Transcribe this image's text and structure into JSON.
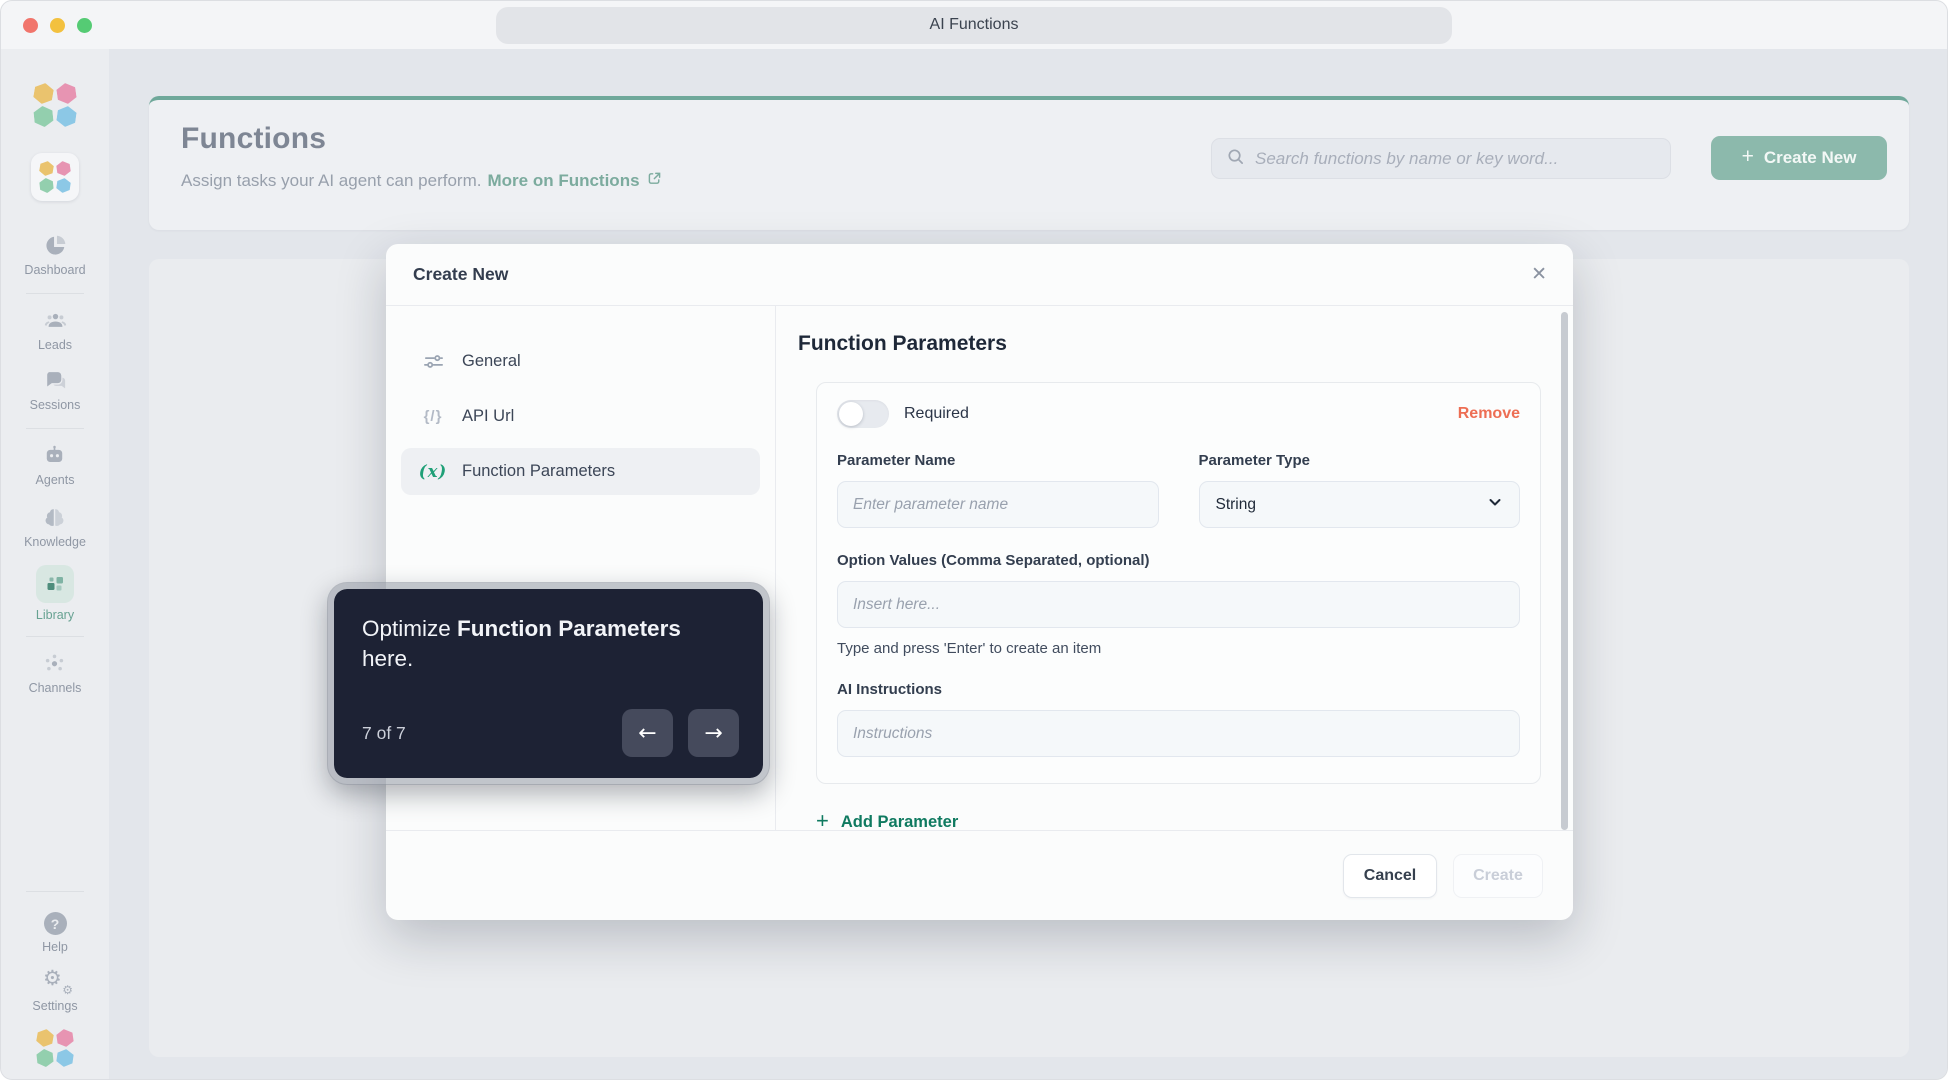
{
  "window": {
    "title": "AI Functions"
  },
  "sidebar": {
    "items": [
      {
        "label": "Dashboard",
        "icon": "pie-chart-icon"
      },
      {
        "label": "Leads",
        "icon": "people-icon"
      },
      {
        "label": "Sessions",
        "icon": "chat-bubbles-icon"
      },
      {
        "label": "Agents",
        "icon": "robot-icon"
      },
      {
        "label": "Knowledge",
        "icon": "brain-icon"
      },
      {
        "label": "Library",
        "icon": "grid-squares-icon",
        "active": true
      },
      {
        "label": "Channels",
        "icon": "network-icon"
      },
      {
        "label": "Help",
        "icon": "question-circle-icon"
      },
      {
        "label": "Settings",
        "icon": "gears-icon"
      }
    ]
  },
  "header": {
    "title": "Functions",
    "subtitle": "Assign tasks your AI agent can perform.",
    "link_label": "More on Functions",
    "search_placeholder": "Search functions by name or key word...",
    "create_button": "Create New"
  },
  "modal": {
    "title": "Create New",
    "nav": [
      {
        "label": "General"
      },
      {
        "label": "API Url"
      },
      {
        "label": "Function Parameters",
        "active": true
      }
    ],
    "section_title": "Function Parameters",
    "parameter": {
      "required_label": "Required",
      "required_on": false,
      "remove_label": "Remove",
      "name_label": "Parameter Name",
      "name_placeholder": "Enter parameter name",
      "name_value": "",
      "type_label": "Parameter Type",
      "type_value": "String",
      "options_label": "Option Values (Comma Separated, optional)",
      "options_placeholder": "Insert here...",
      "options_value": "",
      "options_help": "Type and press 'Enter' to create an item",
      "instructions_label": "AI Instructions",
      "instructions_placeholder": "Instructions",
      "instructions_value": ""
    },
    "add_parameter_label": "Add Parameter",
    "cancel_label": "Cancel",
    "create_label": "Create",
    "create_enabled": false
  },
  "tour": {
    "text_prefix": "Optimize ",
    "text_bold": "Function Parameters",
    "text_suffix": " here.",
    "step": "7 of 7"
  },
  "icons": {
    "close": "✕",
    "plus": "+",
    "back_arrow": "←",
    "forward_arrow": "→",
    "api_url": "{/}",
    "function_params": "(x)",
    "gear": "⚙",
    "question": "?"
  },
  "colors": {
    "accent_teal": "#8cb9ac",
    "link_teal": "#7cab9e",
    "active_green": "#1fa077",
    "add_green": "#0f7a60",
    "remove_coral": "#ed6e54",
    "tooltip_bg": "#1d2234",
    "modal_bg": "#fbfcfc",
    "app_bg": "#e3e6eb",
    "sidebar_bg": "#ebedf0"
  }
}
